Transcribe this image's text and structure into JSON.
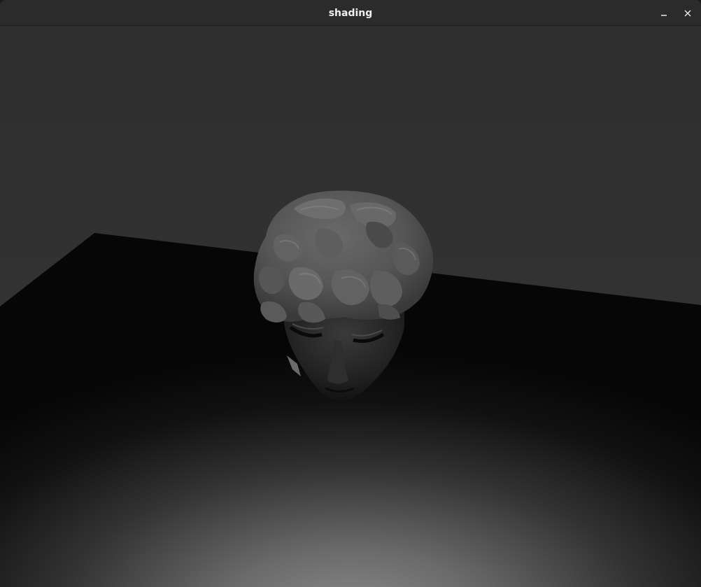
{
  "window": {
    "title": "shading",
    "minimize_icon": "minimize-icon",
    "close_icon": "close-icon"
  },
  "scene": {
    "background_color": "#303030",
    "floor_color": "#0e0e0e",
    "floor_highlight_color": "#7a7a7a",
    "model_color": "#5a5a5a",
    "model_name": "sculpted-head"
  }
}
